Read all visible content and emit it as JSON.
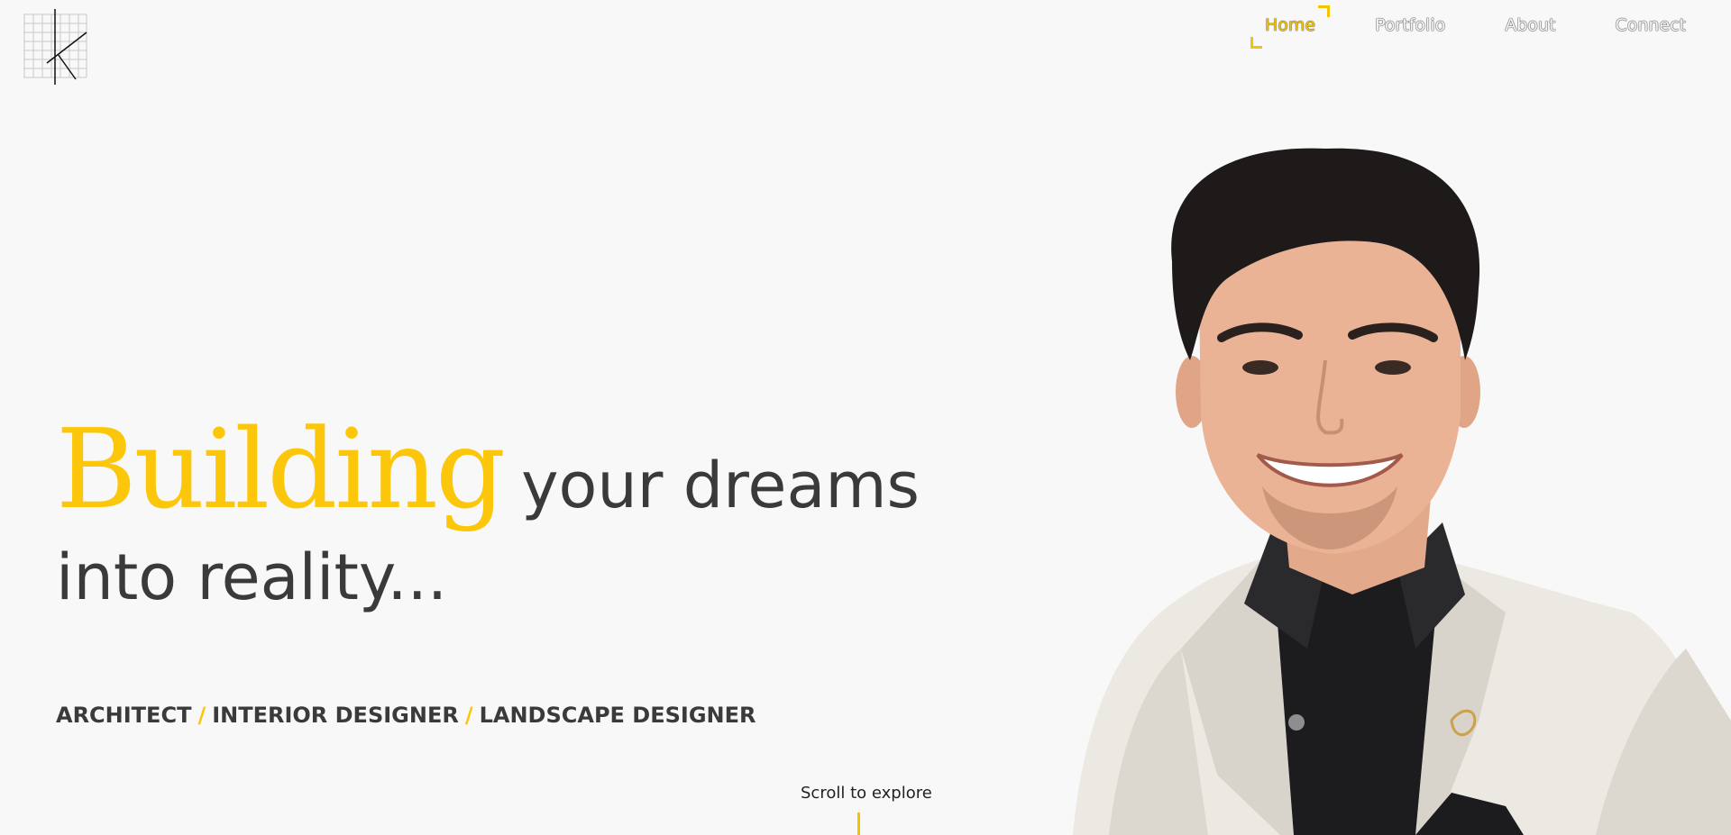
{
  "nav": {
    "items": [
      {
        "label": "Home",
        "active": true
      },
      {
        "label": "Portfolio",
        "active": false
      },
      {
        "label": "About",
        "active": false
      },
      {
        "label": "Connect",
        "active": false
      }
    ]
  },
  "hero": {
    "accent_word": "Building",
    "line1_rest": "your dreams",
    "line2": "into reality..."
  },
  "roles": {
    "role1": "ARCHITECT",
    "role2": "INTERIOR DESIGNER",
    "role3": "LANDSCAPE DESIGNER",
    "separator": "/"
  },
  "scroll": {
    "label": "Scroll to explore"
  },
  "colors": {
    "accent": "#fcc70a",
    "text": "#3a3a3a",
    "background": "#f8f8f8"
  },
  "icons": {
    "logo": "k-monogram-grid-logo"
  }
}
